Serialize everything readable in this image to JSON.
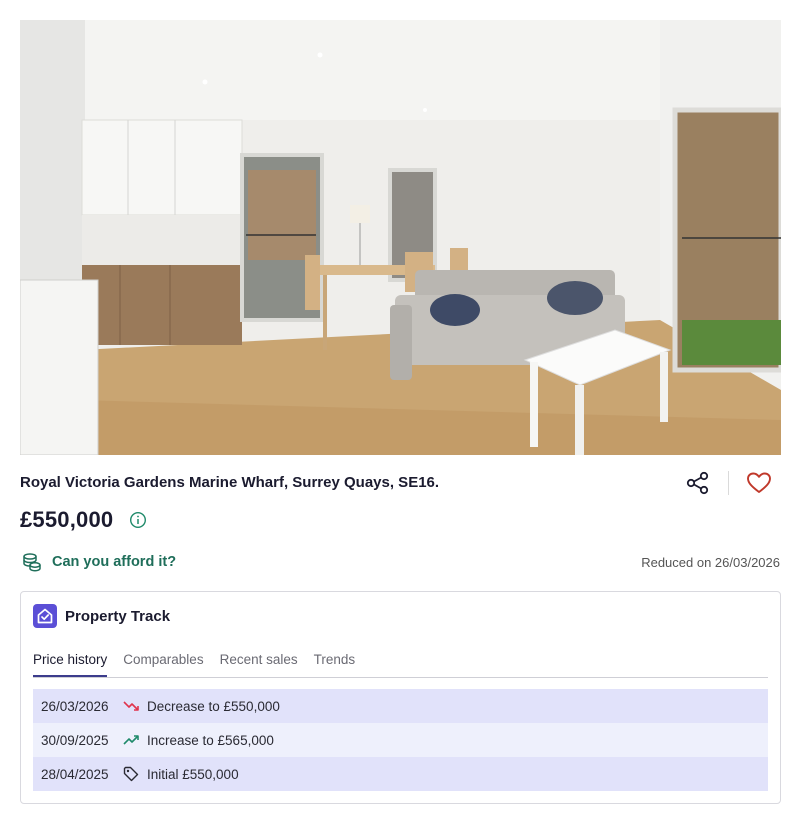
{
  "listing": {
    "title": "Royal Victoria Gardens Marine Wharf, Surrey Quays, SE16.",
    "price": "£550,000",
    "afford_link": "Can you afford it?",
    "reduced_text": "Reduced on 26/03/2026",
    "photo_alt": "Open-plan living room with kitchen, dining table, grey sofa and white coffee table"
  },
  "icons": {
    "share": "share-icon",
    "favourite": "heart-icon",
    "info": "info-icon",
    "afford": "coins-icon",
    "track_logo": "house-check-icon"
  },
  "property_track": {
    "title": "Property Track",
    "tabs": [
      {
        "label": "Price history",
        "active": true
      },
      {
        "label": "Comparables",
        "active": false
      },
      {
        "label": "Recent sales",
        "active": false
      },
      {
        "label": "Trends",
        "active": false
      }
    ],
    "history": [
      {
        "date": "26/03/2026",
        "icon": "trend-down-icon",
        "text": "Decrease to £550,000"
      },
      {
        "date": "30/09/2025",
        "icon": "trend-up-icon",
        "text": "Increase to £565,000"
      },
      {
        "date": "28/04/2025",
        "icon": "tag-icon",
        "text": "Initial £550,000"
      }
    ]
  },
  "colors": {
    "accent_purple": "#5b4fd6",
    "afford_green": "#1f6e5a",
    "heart_red": "#c0392b",
    "trend_down": "#e0334c",
    "trend_up": "#1f8a6a",
    "row_odd": "#e1e2fa",
    "row_even": "#eef0fc"
  }
}
